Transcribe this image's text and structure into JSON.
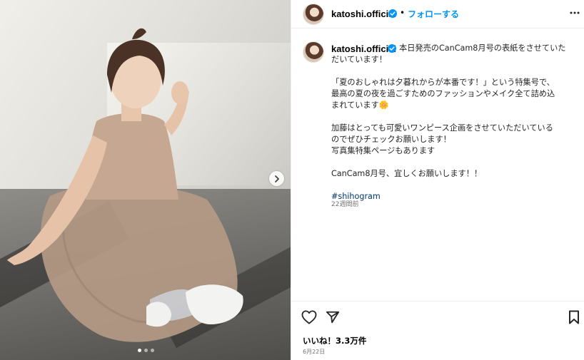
{
  "post": {
    "username": "katoshi.official",
    "separator": "•",
    "follow_label": "フォローする",
    "more_icon": "more-horizontal-icon",
    "verified_icon": "verified-badge-icon",
    "caption_lines": {
      "l1": "本日発売のCanCam8月号の表紙をさせていた",
      "l2": "だいています！",
      "l3": "「夏のおしゃれは夕暮れからが本番です！」という特集号で、",
      "l4": "最高の夏の夜を過ごすためのファッションやメイク全て詰め込",
      "l5": "まれています🌼",
      "l6": "加藤はとっても可愛いワンピース企画をさせていただいている",
      "l7": "のでぜひチェックお願いします！",
      "l8": "写真集特集ページもあります",
      "l9": "CanCam8月号、宜しくお願いします！！",
      "hashtag": "#shihogram"
    },
    "time_ago": "22週間前",
    "likes": "いいね！3.3万件",
    "date": "6月22日",
    "icons": {
      "like": "heart-icon",
      "share": "send-icon",
      "save": "bookmark-icon",
      "next": "chevron-right-icon"
    },
    "carousel": {
      "total": 3,
      "active": 1
    }
  }
}
